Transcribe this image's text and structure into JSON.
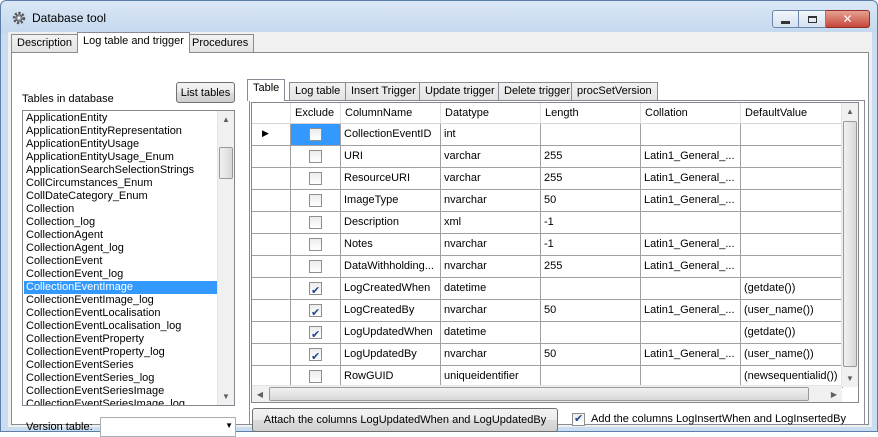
{
  "window": {
    "title": "Database tool"
  },
  "outer_tabs": [
    "Description",
    "Log table and trigger",
    "Procedures"
  ],
  "left": {
    "tables_label": "Tables in database",
    "list_tables_button": "List tables",
    "tables": [
      "ApplicationEntity",
      "ApplicationEntityRepresentation",
      "ApplicationEntityUsage",
      "ApplicationEntityUsage_Enum",
      "ApplicationSearchSelectionStrings",
      "CollCircumstances_Enum",
      "CollDateCategory_Enum",
      "Collection",
      "Collection_log",
      "CollectionAgent",
      "CollectionAgent_log",
      "CollectionEvent",
      "CollectionEvent_log",
      "CollectionEventImage",
      "CollectionEventImage_log",
      "CollectionEventLocalisation",
      "CollectionEventLocalisation_log",
      "CollectionEventProperty",
      "CollectionEventProperty_log",
      "CollectionEventSeries",
      "CollectionEventSeries_log",
      "CollectionEventSeriesImage",
      "CollectionEventSeriesImage_log"
    ],
    "selected_table": "CollectionEventImage",
    "version_label": "Version table:",
    "version_value": ""
  },
  "inner_tabs": [
    "Table",
    "Log table",
    "Insert Trigger",
    "Update trigger",
    "Delete trigger",
    "procSetVersion"
  ],
  "grid": {
    "columns": [
      "Exclude",
      "ColumnName",
      "Datatype",
      "Length",
      "Collation",
      "DefaultValue"
    ],
    "rows": [
      {
        "exclude": false,
        "name": "CollectionEventID",
        "type": "int",
        "length": "",
        "collation": "",
        "default": ""
      },
      {
        "exclude": false,
        "name": "URI",
        "type": "varchar",
        "length": "255",
        "collation": "Latin1_General_...",
        "default": ""
      },
      {
        "exclude": false,
        "name": "ResourceURI",
        "type": "varchar",
        "length": "255",
        "collation": "Latin1_General_...",
        "default": ""
      },
      {
        "exclude": false,
        "name": "ImageType",
        "type": "nvarchar",
        "length": "50",
        "collation": "Latin1_General_...",
        "default": ""
      },
      {
        "exclude": false,
        "name": "Description",
        "type": "xml",
        "length": "-1",
        "collation": "",
        "default": ""
      },
      {
        "exclude": false,
        "name": "Notes",
        "type": "nvarchar",
        "length": "-1",
        "collation": "Latin1_General_...",
        "default": ""
      },
      {
        "exclude": false,
        "name": "DataWithholding...",
        "type": "nvarchar",
        "length": "255",
        "collation": "Latin1_General_...",
        "default": ""
      },
      {
        "exclude": true,
        "name": "LogCreatedWhen",
        "type": "datetime",
        "length": "",
        "collation": "",
        "default": "(getdate())"
      },
      {
        "exclude": true,
        "name": "LogCreatedBy",
        "type": "nvarchar",
        "length": "50",
        "collation": "Latin1_General_...",
        "default": "(user_name())"
      },
      {
        "exclude": true,
        "name": "LogUpdatedWhen",
        "type": "datetime",
        "length": "",
        "collation": "",
        "default": "(getdate())"
      },
      {
        "exclude": true,
        "name": "LogUpdatedBy",
        "type": "nvarchar",
        "length": "50",
        "collation": "Latin1_General_...",
        "default": "(user_name())"
      },
      {
        "exclude": false,
        "name": "RowGUID",
        "type": "uniqueidentifier",
        "length": "",
        "collation": "",
        "default": "(newsequentialid())"
      }
    ]
  },
  "bottom": {
    "attach_button": "Attach the columns LogUpdatedWhen and LogUpdatedBy",
    "add_columns_checked": true,
    "add_columns_label": "Add the columns LogInsertWhen and LogInsertedBy"
  }
}
